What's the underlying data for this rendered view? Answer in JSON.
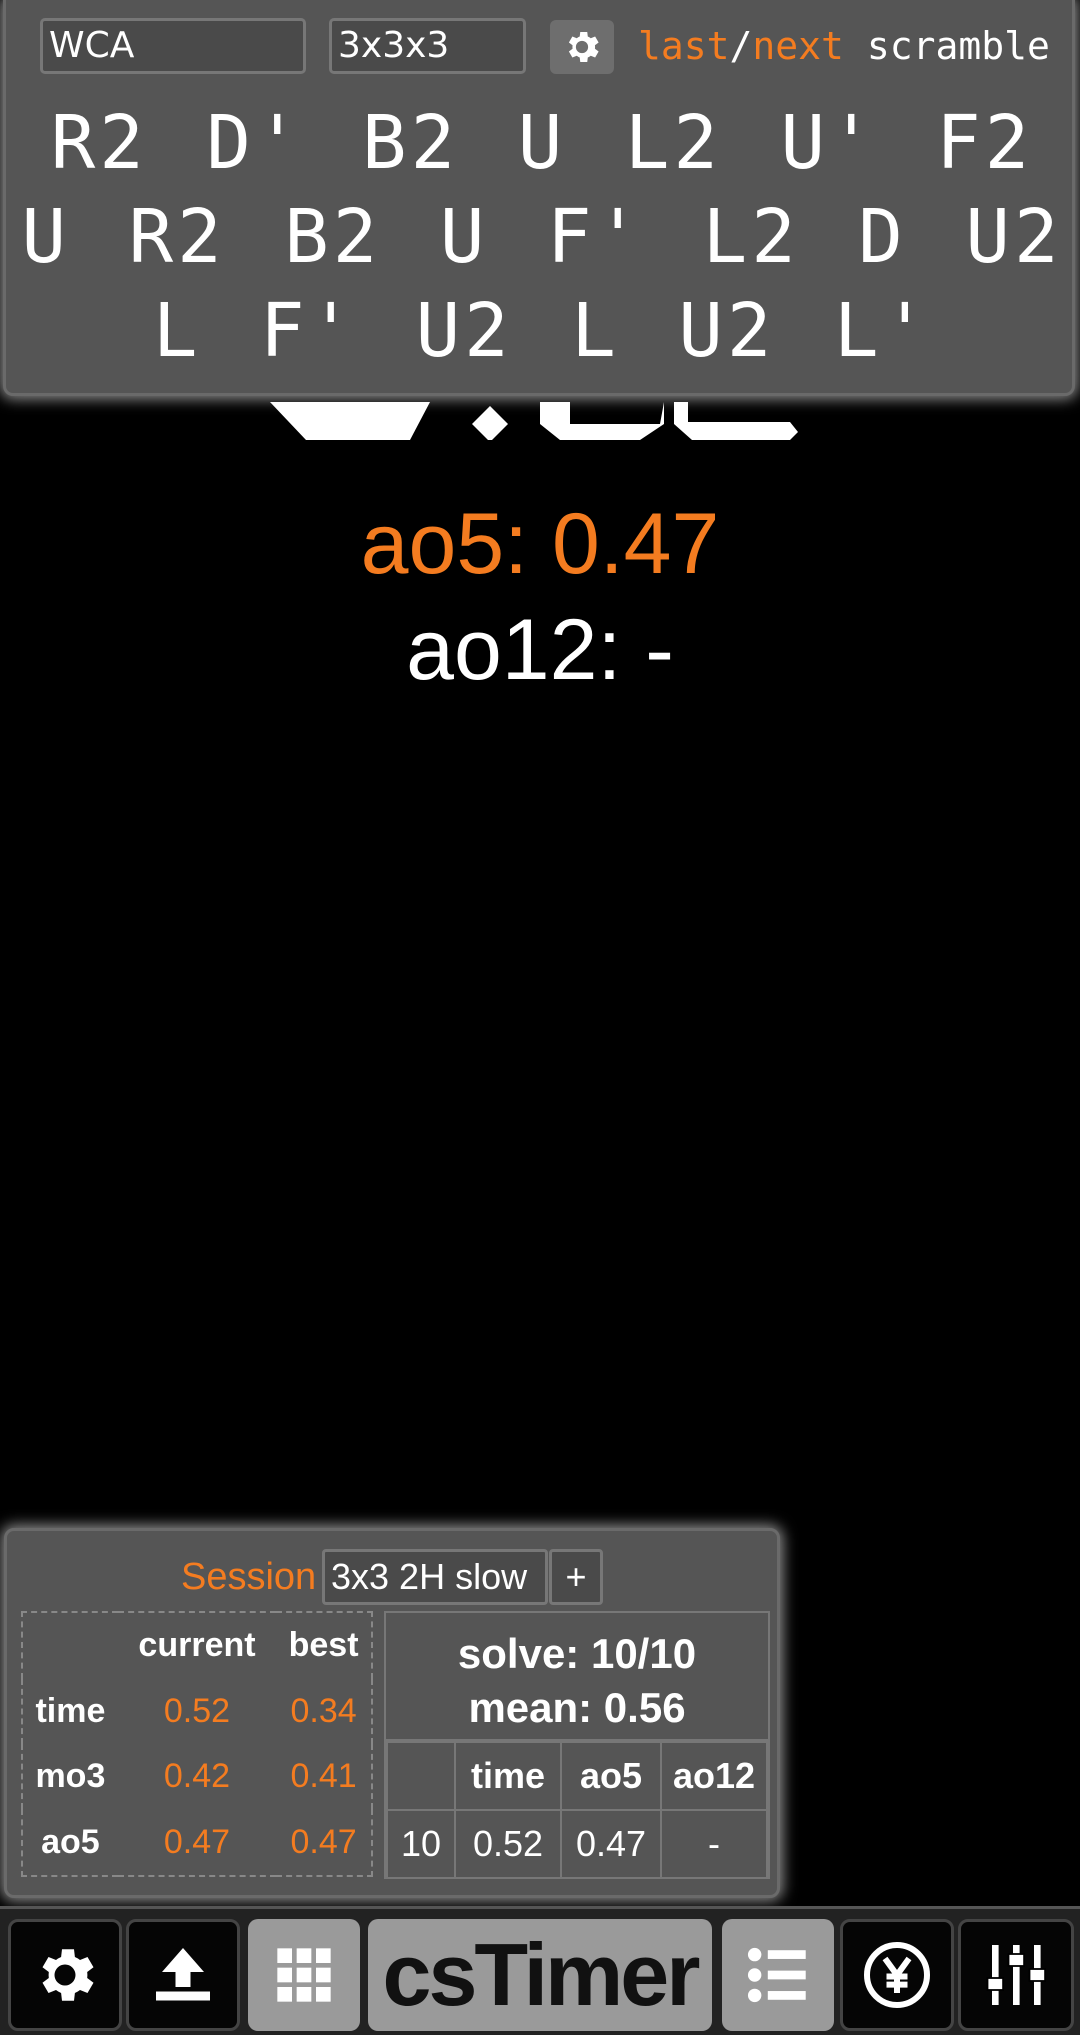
{
  "scramble": {
    "type_select": "WCA",
    "puzzle_select": "3x3x3",
    "last_label": "last",
    "separator": "/",
    "next_label": "next",
    "scramble_label": "scramble",
    "text": "R2 D' B2 U L2 U' F2 U R2 B2 U F' L2 D U2 L F' U2 L U2 L'"
  },
  "averages": {
    "ao5": "ao5: 0.47",
    "ao12": "ao12: -"
  },
  "stats": {
    "session_label": "Session",
    "session_name": "3x3 2H slow",
    "add_label": "+",
    "header": {
      "current": "current",
      "best": "best"
    },
    "rows": [
      {
        "label": "time",
        "current": "0.52",
        "best": "0.34"
      },
      {
        "label": "mo3",
        "current": "0.42",
        "best": "0.41"
      },
      {
        "label": "ao5",
        "current": "0.47",
        "best": "0.47"
      }
    ],
    "solve_count": "solve: 10/10",
    "mean": "mean: 0.56",
    "solves_header": {
      "index": "",
      "time": "time",
      "ao5": "ao5",
      "ao12": "ao12"
    },
    "solves": [
      {
        "index": "10",
        "time": "0.52",
        "ao5": "0.47",
        "ao12": "-"
      }
    ]
  },
  "toolbar": {
    "logo": "csTimer",
    "icons": [
      "gear-icon",
      "export-icon",
      "grid-icon",
      "list-icon",
      "yen-icon",
      "sliders-icon"
    ]
  },
  "colors": {
    "accent": "#f47c20",
    "panel": "#555555",
    "background": "#000000"
  }
}
